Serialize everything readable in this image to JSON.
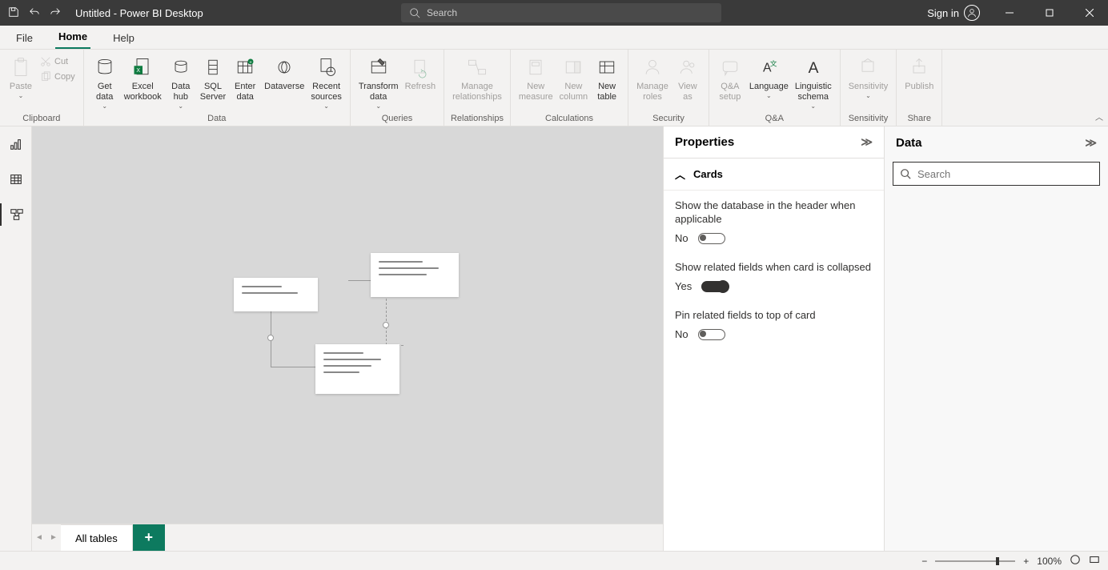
{
  "titlebar": {
    "title": "Untitled - Power BI Desktop",
    "search_placeholder": "Search",
    "signin": "Sign in"
  },
  "ribbon_tabs": {
    "file": "File",
    "home": "Home",
    "help": "Help"
  },
  "ribbon": {
    "clipboard": {
      "label": "Clipboard",
      "paste": "Paste",
      "cut": "Cut",
      "copy": "Copy"
    },
    "data": {
      "label": "Data",
      "get_data": "Get\ndata",
      "excel": "Excel\nworkbook",
      "data_hub": "Data\nhub",
      "sql_server": "SQL\nServer",
      "enter_data": "Enter\ndata",
      "dataverse": "Dataverse",
      "recent_sources": "Recent\nsources"
    },
    "queries": {
      "label": "Queries",
      "transform_data": "Transform\ndata",
      "refresh": "Refresh"
    },
    "relationships": {
      "label": "Relationships",
      "manage": "Manage\nrelationships"
    },
    "calculations": {
      "label": "Calculations",
      "new_measure": "New\nmeasure",
      "new_column": "New\ncolumn",
      "new_table": "New\ntable"
    },
    "security": {
      "label": "Security",
      "manage_roles": "Manage\nroles",
      "view_as": "View\nas"
    },
    "qa": {
      "label": "Q&A",
      "qa_setup": "Q&A\nsetup",
      "language": "Language",
      "linguistic_schema": "Linguistic\nschema"
    },
    "sensitivity": {
      "label": "Sensitivity",
      "sensitivity": "Sensitivity"
    },
    "share": {
      "label": "Share",
      "publish": "Publish"
    }
  },
  "tabs": {
    "all_tables": "All tables"
  },
  "properties": {
    "title": "Properties",
    "section": "Cards",
    "setting1": {
      "desc": "Show the database in the header when applicable",
      "value": "No"
    },
    "setting2": {
      "desc": "Show related fields when card is collapsed",
      "value": "Yes"
    },
    "setting3": {
      "desc": "Pin related fields to top of card",
      "value": "No"
    }
  },
  "data_pane": {
    "title": "Data",
    "search_placeholder": "Search"
  },
  "statusbar": {
    "zoom": "100%"
  }
}
